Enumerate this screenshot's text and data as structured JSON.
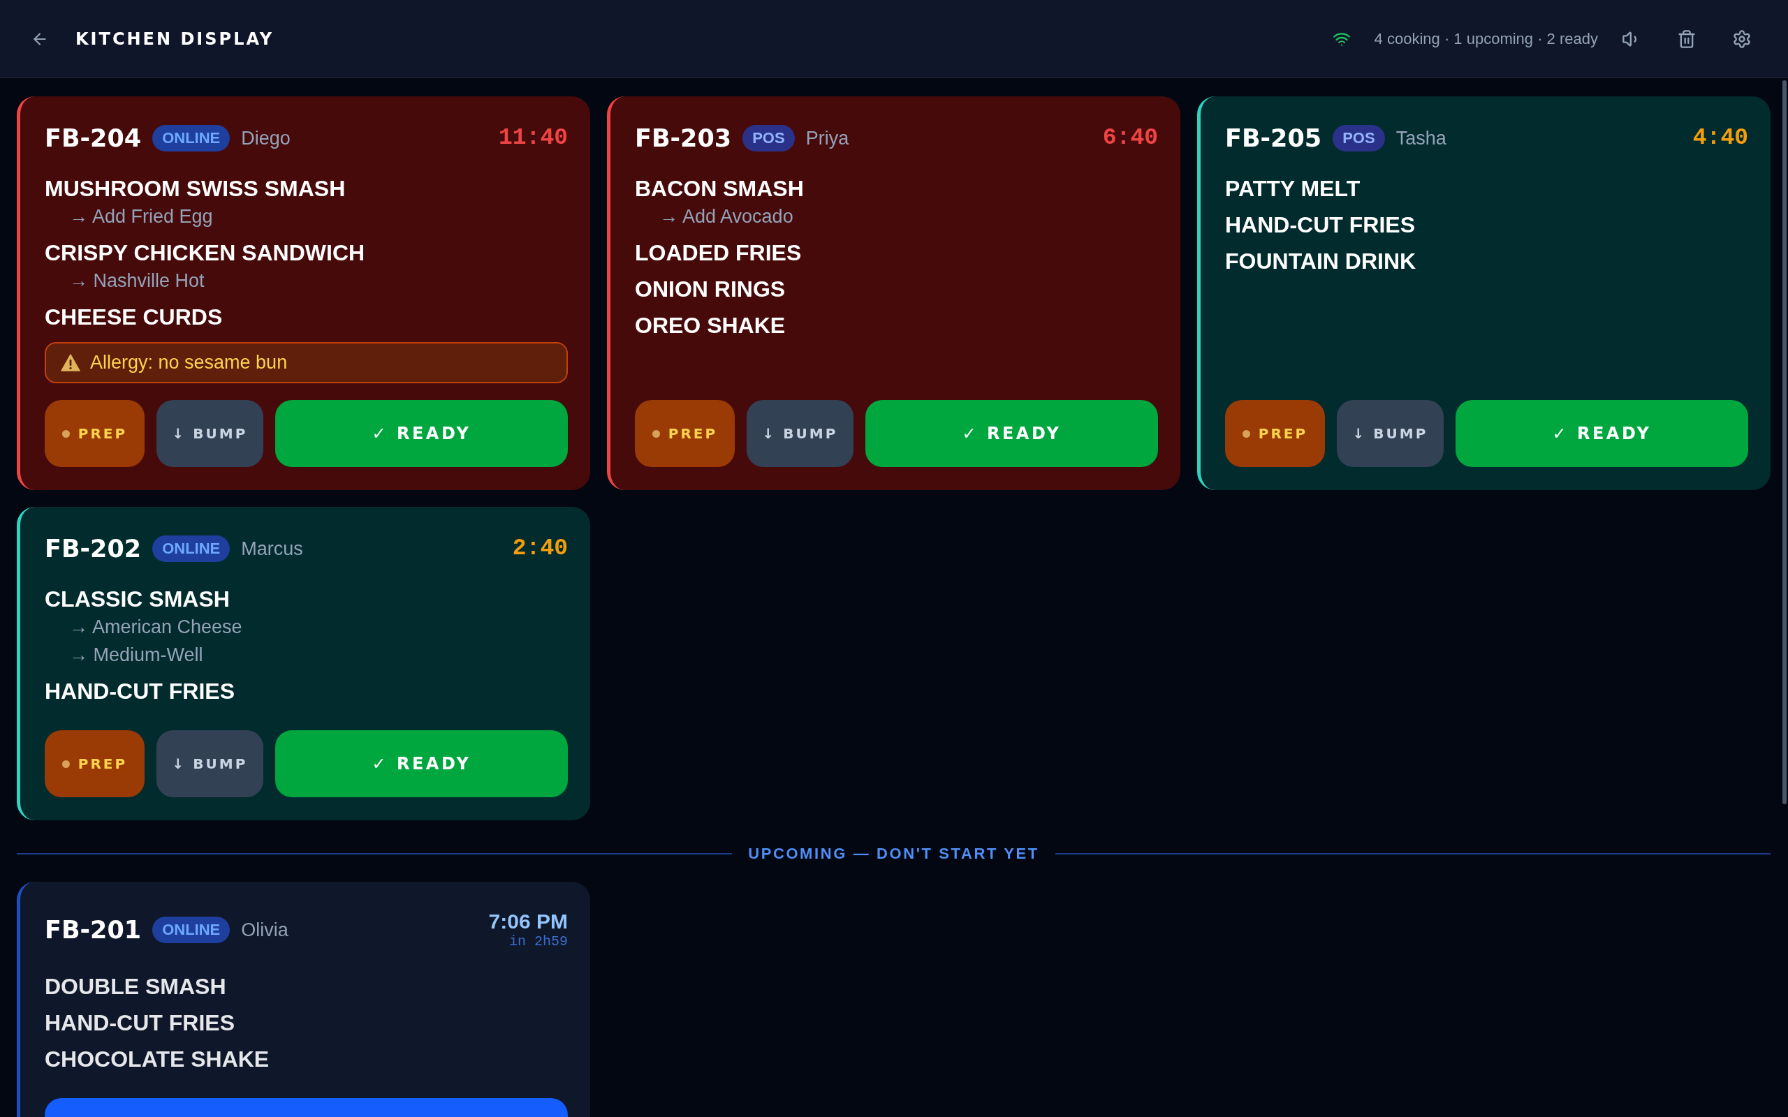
{
  "header": {
    "title": "KITCHEN DISPLAY",
    "connected": true,
    "summary": "4 cooking · 1 upcoming · 2 ready"
  },
  "orders": [
    {
      "id": "FB-204",
      "source": {
        "label": "ONLINE",
        "kind": "online"
      },
      "customer": "Diego",
      "timer": "11:40",
      "late": true,
      "items": [
        {
          "name": "MUSHROOM SWISS SMASH",
          "modifiers": [
            "→ Add Fried Egg"
          ]
        },
        {
          "name": "CRISPY CHICKEN SANDWICH",
          "modifiers": [
            "→ Nashville Hot"
          ]
        },
        {
          "name": "CHEESE CURDS"
        }
      ],
      "allergy": "Allergy: no sesame bun",
      "actions": [
        {
          "kind": "prep",
          "label": "PREP"
        },
        {
          "kind": "bump",
          "label": "↓ BUMP"
        },
        {
          "kind": "ready",
          "label": "✓ READY"
        }
      ]
    },
    {
      "id": "FB-203",
      "source": {
        "label": "POS",
        "kind": "pos"
      },
      "customer": "Priya",
      "timer": "6:40",
      "late": true,
      "items": [
        {
          "name": "BACON SMASH",
          "modifiers": [
            "→ Add Avocado"
          ]
        },
        {
          "name": "LOADED FRIES"
        },
        {
          "name": "ONION RINGS"
        },
        {
          "name": "OREO SHAKE"
        }
      ],
      "actions": [
        {
          "kind": "prep",
          "label": "PREP"
        },
        {
          "kind": "bump",
          "label": "↓ BUMP"
        },
        {
          "kind": "ready",
          "label": "✓ READY"
        }
      ]
    },
    {
      "id": "FB-205",
      "source": {
        "label": "POS",
        "kind": "pos"
      },
      "customer": "Tasha",
      "timer": "4:40",
      "late": false,
      "items": [
        {
          "name": "PATTY MELT"
        },
        {
          "name": "HAND-CUT FRIES"
        },
        {
          "name": "FOUNTAIN DRINK"
        }
      ],
      "actions": [
        {
          "kind": "prep",
          "label": "PREP"
        },
        {
          "kind": "bump",
          "label": "↓ BUMP"
        },
        {
          "kind": "ready",
          "label": "✓ READY"
        }
      ]
    },
    {
      "id": "FB-202",
      "source": {
        "label": "ONLINE",
        "kind": "online"
      },
      "customer": "Marcus",
      "timer": "2:40",
      "late": false,
      "items": [
        {
          "name": "CLASSIC SMASH",
          "modifiers": [
            "→ American Cheese",
            "→ Medium-Well"
          ]
        },
        {
          "name": "HAND-CUT FRIES"
        }
      ],
      "actions": [
        {
          "kind": "prep",
          "label": "PREP"
        },
        {
          "kind": "bump",
          "label": "↓ BUMP"
        },
        {
          "kind": "ready",
          "label": "✓ READY"
        }
      ]
    }
  ],
  "upcoming": {
    "heading": "UPCOMING — DON'T START YET",
    "orders": [
      {
        "id": "FB-201",
        "source": {
          "label": "ONLINE",
          "kind": "online"
        },
        "customer": "Olivia",
        "scheduled_time": "7:06 PM",
        "countdown": "in 2h59",
        "items": [
          {
            "name": "DOUBLE SMASH"
          },
          {
            "name": "HAND-CUT FRIES"
          },
          {
            "name": "CHOCOLATE SHAKE"
          }
        ],
        "actions": [
          {
            "kind": "primary"
          }
        ]
      }
    ]
  }
}
